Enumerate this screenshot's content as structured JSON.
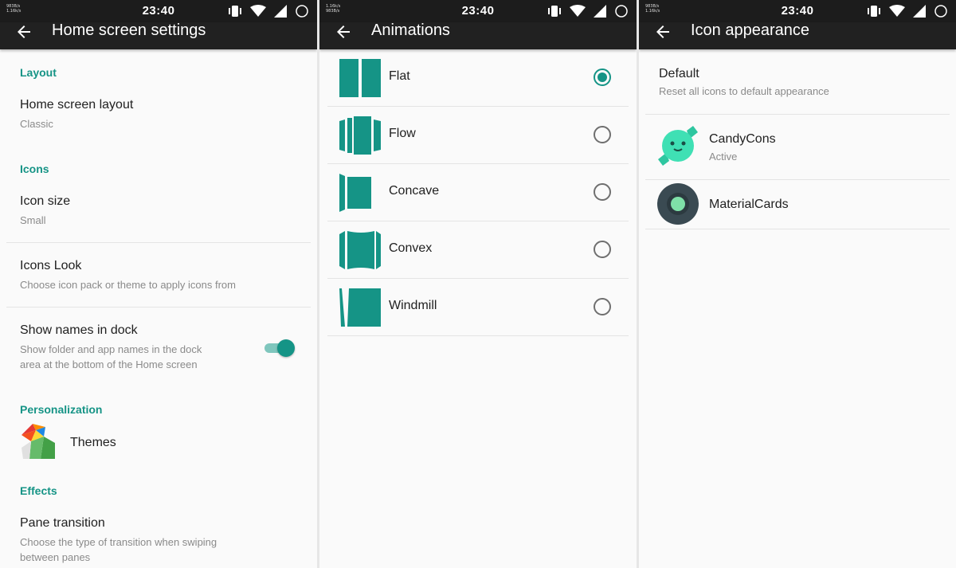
{
  "status_bar": {
    "time": "23:40",
    "speed_left_1": "983B/s",
    "speed_left_2": "1.16k/s"
  },
  "screen_home": {
    "title": "Home screen settings",
    "sections": {
      "layout": "Layout",
      "icons": "Icons",
      "personalization": "Personalization",
      "effects": "Effects"
    },
    "items": {
      "home_layout": {
        "title": "Home screen layout",
        "subtitle": "Classic"
      },
      "icon_size": {
        "title": "Icon size",
        "subtitle": "Small"
      },
      "icons_look": {
        "title": "Icons Look",
        "subtitle": "Choose icon pack or theme to apply icons from"
      },
      "show_names": {
        "title": "Show names in dock",
        "subtitle_1": "Show folder and app names in the dock",
        "subtitle_2": "area at the bottom of the Home screen",
        "enabled": true
      },
      "themes": {
        "title": "Themes"
      },
      "pane_transition": {
        "title": "Pane transition",
        "subtitle_1": "Choose the type of transition when swiping",
        "subtitle_2": "between panes"
      }
    }
  },
  "screen_animations": {
    "title": "Animations",
    "options": [
      {
        "label": "Flat",
        "selected": true
      },
      {
        "label": "Flow",
        "selected": false
      },
      {
        "label": "Concave",
        "selected": false
      },
      {
        "label": "Convex",
        "selected": false
      },
      {
        "label": "Windmill",
        "selected": false
      }
    ]
  },
  "screen_icon_appearance": {
    "title": "Icon appearance",
    "default": {
      "title": "Default",
      "subtitle": "Reset all icons to default appearance"
    },
    "packs": [
      {
        "name": "CandyCons",
        "status": "Active"
      },
      {
        "name": "MaterialCards",
        "status": ""
      }
    ]
  },
  "colors": {
    "accent": "#159486",
    "appbar": "#212121",
    "statusbar": "#1c1c1c"
  }
}
